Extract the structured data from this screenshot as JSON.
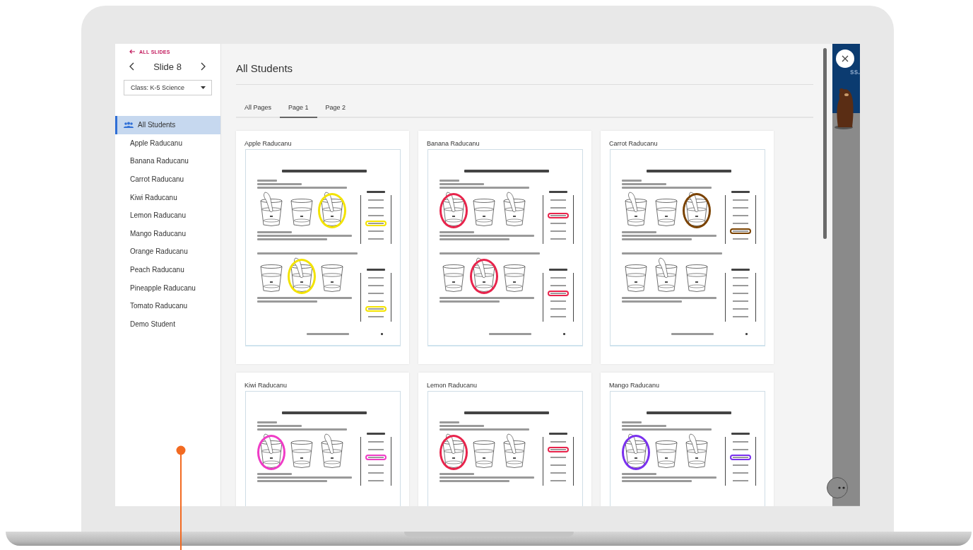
{
  "sidebar": {
    "back_link": "ALL SLIDES",
    "slide_title": "Slide 8",
    "class_select": {
      "value": "Class: K-5 Science"
    },
    "students": [
      {
        "name": "All Students",
        "kind": "group",
        "selected": true
      },
      {
        "name": "Apple Raducanu",
        "kind": "student",
        "selected": false
      },
      {
        "name": "Banana Raducanu",
        "kind": "student",
        "selected": false
      },
      {
        "name": "Carrot Raducanu",
        "kind": "student",
        "selected": false
      },
      {
        "name": "Kiwi Raducanu",
        "kind": "student",
        "selected": false
      },
      {
        "name": "Lemon Raducanu",
        "kind": "student",
        "selected": false
      },
      {
        "name": "Mango Raducanu",
        "kind": "student",
        "selected": false
      },
      {
        "name": "Orange Raducanu",
        "kind": "student",
        "selected": false
      },
      {
        "name": "Peach Raducanu",
        "kind": "student",
        "selected": false
      },
      {
        "name": "Pineapple Raducanu",
        "kind": "student",
        "selected": false
      },
      {
        "name": "Tomato Raducanu",
        "kind": "student",
        "selected": false
      },
      {
        "name": "Demo Student",
        "kind": "student",
        "selected": false
      }
    ]
  },
  "main": {
    "title": "All Students",
    "tabs": [
      {
        "label": "All Pages",
        "selected": false
      },
      {
        "label": "Page 1",
        "selected": true
      },
      {
        "label": "Page 2",
        "selected": false
      }
    ],
    "cards": [
      {
        "student": "Apple Raducanu",
        "color": "#f3e300",
        "worksheet": {
          "cups": [
            {
              "finger": true,
              "circled": false
            },
            {
              "finger": false,
              "circled": false
            },
            {
              "finger": true,
              "circled": true
            }
          ],
          "options": [
            {
              "circled": false
            },
            {
              "circled": false
            },
            {
              "circled": false
            },
            {
              "circled": true
            },
            {
              "circled": false
            },
            {
              "circled": false
            }
          ],
          "part_two": {
            "cups": [
              {
                "finger": false,
                "circled": false
              },
              {
                "finger": true,
                "circled": true
              },
              {
                "finger": false,
                "circled": false
              }
            ],
            "options": [
              {
                "circled": false
              },
              {
                "circled": false
              },
              {
                "circled": false
              },
              {
                "circled": false
              },
              {
                "circled": true
              },
              {
                "circled": false
              }
            ]
          }
        }
      },
      {
        "student": "Banana Raducanu",
        "color": "#e8244c",
        "worksheet": {
          "cups": [
            {
              "finger": true,
              "circled": true
            },
            {
              "finger": false,
              "circled": false
            },
            {
              "finger": true,
              "circled": false
            }
          ],
          "options": [
            {
              "circled": false
            },
            {
              "circled": false
            },
            {
              "circled": true
            },
            {
              "circled": false
            },
            {
              "circled": false
            },
            {
              "circled": false
            }
          ],
          "part_two": {
            "cups": [
              {
                "finger": false,
                "circled": false
              },
              {
                "finger": true,
                "circled": true
              },
              {
                "finger": false,
                "circled": false
              }
            ],
            "options": [
              {
                "circled": false
              },
              {
                "circled": false
              },
              {
                "circled": true
              },
              {
                "circled": false
              },
              {
                "circled": false
              },
              {
                "circled": false
              }
            ]
          }
        }
      },
      {
        "student": "Carrot Raducanu",
        "color": "#7a4200",
        "worksheet": {
          "cups": [
            {
              "finger": true,
              "circled": false
            },
            {
              "finger": false,
              "circled": false
            },
            {
              "finger": true,
              "circled": true
            }
          ],
          "options": [
            {
              "circled": false
            },
            {
              "circled": false
            },
            {
              "circled": false
            },
            {
              "circled": false
            },
            {
              "circled": true
            },
            {
              "circled": false
            }
          ],
          "part_two": {
            "cups": [
              {
                "finger": false,
                "circled": false
              },
              {
                "finger": true,
                "circled": false
              },
              {
                "finger": false,
                "circled": false
              }
            ],
            "options": [
              {
                "circled": false
              },
              {
                "circled": false
              },
              {
                "circled": false
              },
              {
                "circled": false
              },
              {
                "circled": false
              },
              {
                "circled": false
              }
            ]
          }
        }
      },
      {
        "student": "Kiwi Raducanu",
        "color": "#ef3cc6",
        "worksheet": {
          "cups": [
            {
              "finger": true,
              "circled": true
            },
            {
              "finger": false,
              "circled": false
            },
            {
              "finger": true,
              "circled": false
            }
          ],
          "options": [
            {
              "circled": false
            },
            {
              "circled": false
            },
            {
              "circled": true
            },
            {
              "circled": false
            },
            {
              "circled": false
            },
            {
              "circled": false
            }
          ]
        }
      },
      {
        "student": "Lemon Raducanu",
        "color": "#e8244c",
        "worksheet": {
          "cups": [
            {
              "finger": true,
              "circled": true
            },
            {
              "finger": false,
              "circled": false
            },
            {
              "finger": true,
              "circled": false
            }
          ],
          "options": [
            {
              "circled": false
            },
            {
              "circled": true
            },
            {
              "circled": false
            },
            {
              "circled": false
            },
            {
              "circled": false
            },
            {
              "circled": false
            }
          ]
        }
      },
      {
        "student": "Mango Raducanu",
        "color": "#7a30ee",
        "worksheet": {
          "cups": [
            {
              "finger": true,
              "circled": true
            },
            {
              "finger": false,
              "circled": false
            },
            {
              "finger": true,
              "circled": false
            }
          ],
          "options": [
            {
              "circled": false
            },
            {
              "circled": false
            },
            {
              "circled": true
            },
            {
              "circled": false
            },
            {
              "circled": false
            },
            {
              "circled": false
            }
          ]
        }
      }
    ]
  },
  "backdrop": {
    "banner_text": "ss."
  }
}
